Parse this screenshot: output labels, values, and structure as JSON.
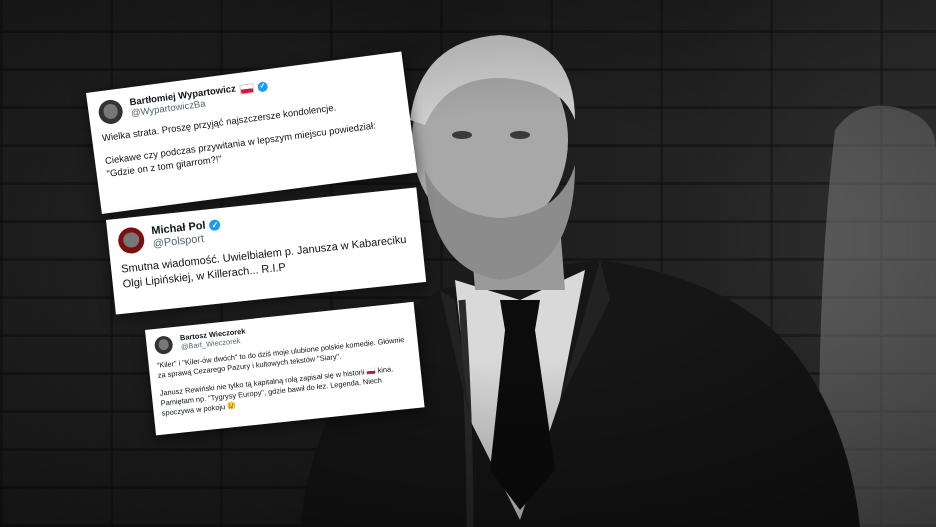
{
  "tweets": [
    {
      "name": "Bartłomiej Wypartowicz",
      "handle": "@WypartowiczBa",
      "has_flag": true,
      "paragraphs": [
        "Wielka strata. Proszę przyjąć najszczersze kondolencje.",
        "Ciekawe czy podczas przywitania w lepszym miejscu powiedział: \"Gdzie on z tom gitarrom?!\""
      ]
    },
    {
      "name": "Michał Pol",
      "handle": "@Polsport",
      "has_flag": false,
      "paragraphs": [
        "Smutna wiadomość. Uwielbiałem p. Janusza w Kabareciku Olgi Lipińskiej, w Killerach... R.I.P"
      ]
    },
    {
      "name": "Bartosz Wieczorek",
      "handle": "@Bart_Wieczorek",
      "has_flag": false,
      "paragraphs": [
        "\"Kiler\" i \"Kiler-ów dwóch\" to do dziś moje ulubione polskie komedie. Głównie za sprawą Cezarego Pazury i kultowych tekstów \"Siary\".",
        "Janusz Rewiński nie tylko tą kapitalną rolą zapisał się w historii 🇵🇱 kina. Pamiętam np. \"Tygrysy Europy\", gdzie bawił do łez. Legenda. Niech spoczywa w pokoju 😢"
      ]
    }
  ],
  "icons": {
    "verified": "verified-badge-icon",
    "flag": "poland-flag-icon"
  },
  "colors": {
    "verified": "#1d9bf0",
    "handle": "#536471",
    "text": "#0f1419"
  }
}
